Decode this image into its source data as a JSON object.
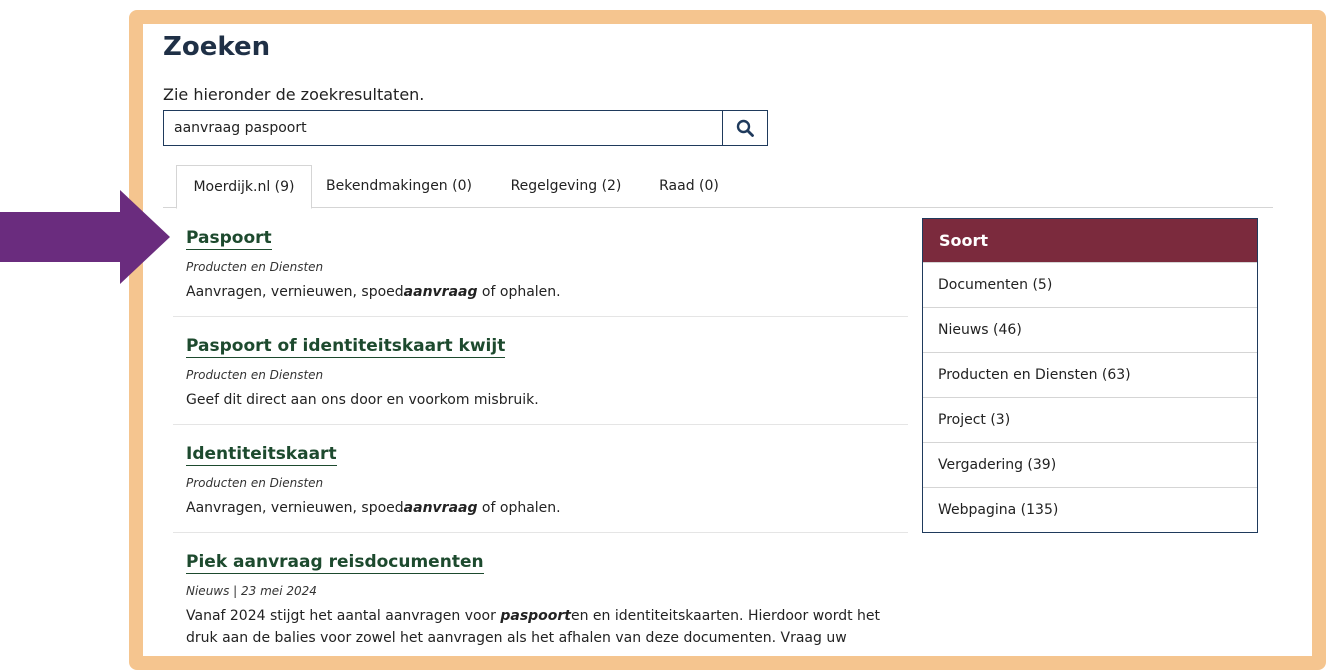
{
  "page": {
    "title": "Zoeken",
    "subtitle": "Zie hieronder de zoekresultaten."
  },
  "search": {
    "value": "aanvraag paspoort",
    "button_icon": "search-icon"
  },
  "tabs": [
    {
      "label": "Moerdijk.nl (9)",
      "active": true
    },
    {
      "label": "Bekendmakingen (0)",
      "active": false
    },
    {
      "label": "Regelgeving (2)",
      "active": false
    },
    {
      "label": "Raad (0)",
      "active": false
    }
  ],
  "results": [
    {
      "title": "Paspoort",
      "meta": "Producten en Diensten",
      "desc_before": "Aanvragen, vernieuwen, spoed",
      "desc_highlight": "aanvraag",
      "desc_after": " of ophalen."
    },
    {
      "title": "Paspoort of identiteitskaart kwijt",
      "meta": "Producten en Diensten",
      "desc": "Geef dit direct aan ons door en voorkom misbruik."
    },
    {
      "title": "Identiteitskaart",
      "meta": "Producten en Diensten",
      "desc_before": "Aanvragen, vernieuwen, spoed",
      "desc_highlight": "aanvraag",
      "desc_after": " of ophalen."
    },
    {
      "title": "Piek aanvraag reisdocumenten",
      "meta": "Nieuws | 23 mei 2024",
      "desc_before": "Vanaf 2024 stijgt het aantal aanvragen voor ",
      "desc_highlight": "paspoort",
      "desc_after": "en en identiteitskaarten. Hierdoor wordt het druk aan de balies voor zowel het aanvragen als het afhalen van deze documenten. Vraag uw"
    }
  ],
  "facet": {
    "header": "Soort",
    "items": [
      "Documenten (5)",
      "Nieuws (46)",
      "Producten en Diensten (63)",
      "Project (3)",
      "Vergadering (39)",
      "Webpagina (135)"
    ]
  },
  "colors": {
    "frame": "#f5c58f",
    "arrow": "#6a2c7e",
    "facet_header": "#7b2a3d",
    "link": "#1d4a2e",
    "title": "#1f3046"
  }
}
